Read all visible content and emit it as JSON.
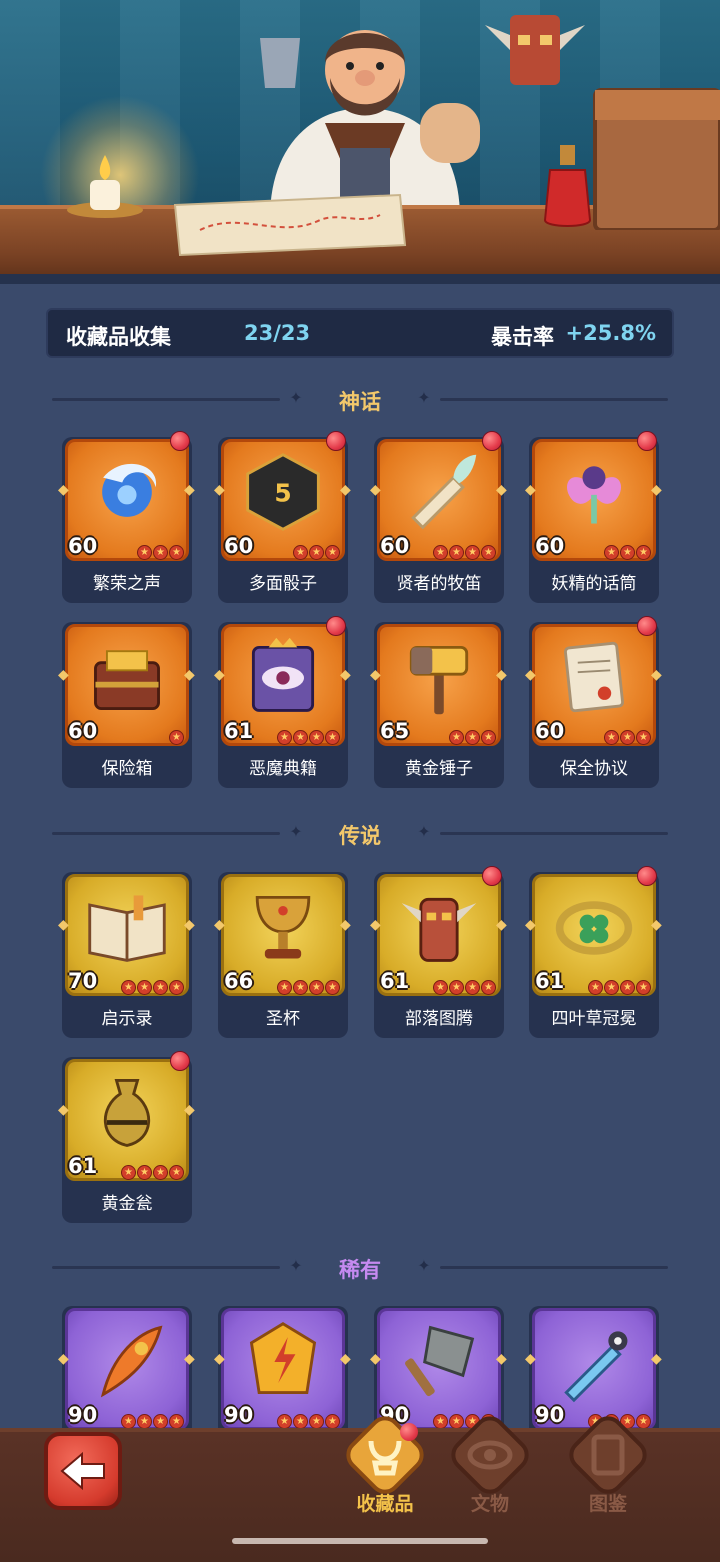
{
  "header": {
    "collection_label": "收藏品收集",
    "collection_count": "23/23",
    "crit_label": "暴击率",
    "crit_value": "+25.8%"
  },
  "sections": [
    {
      "title": "神话",
      "color": "#f3c86b",
      "rarity": "mythic",
      "items": [
        {
          "name": "繁荣之声",
          "level": "60",
          "stars": 3,
          "new": true,
          "icon": "swirl-orb-icon"
        },
        {
          "name": "多面骰子",
          "level": "60",
          "stars": 3,
          "new": true,
          "icon": "d20-dice-icon"
        },
        {
          "name": "贤者的牧笛",
          "level": "60",
          "stars": 4,
          "new": true,
          "icon": "flute-icon"
        },
        {
          "name": "妖精的话筒",
          "level": "60",
          "stars": 3,
          "new": true,
          "icon": "fairy-microphone-icon"
        },
        {
          "name": "保险箱",
          "level": "60",
          "stars": 1,
          "new": false,
          "icon": "treasure-chest-icon"
        },
        {
          "name": "恶魔典籍",
          "level": "61",
          "stars": 4,
          "new": true,
          "icon": "demon-book-icon"
        },
        {
          "name": "黄金锤子",
          "level": "65",
          "stars": 3,
          "new": false,
          "icon": "golden-hammer-icon"
        },
        {
          "name": "保全协议",
          "level": "60",
          "stars": 3,
          "new": true,
          "icon": "scroll-document-icon"
        }
      ]
    },
    {
      "title": "传说",
      "color": "#f3c86b",
      "rarity": "legend",
      "items": [
        {
          "name": "启示录",
          "level": "70",
          "stars": 4,
          "new": false,
          "icon": "open-book-icon"
        },
        {
          "name": "圣杯",
          "level": "66",
          "stars": 4,
          "new": false,
          "icon": "grail-icon"
        },
        {
          "name": "部落图腾",
          "level": "61",
          "stars": 4,
          "new": true,
          "icon": "tribal-totem-icon"
        },
        {
          "name": "四叶草冠冕",
          "level": "61",
          "stars": 4,
          "new": true,
          "icon": "clover-crown-icon"
        },
        {
          "name": "黄金瓮",
          "level": "61",
          "stars": 4,
          "new": true,
          "icon": "golden-urn-icon"
        }
      ]
    },
    {
      "title": "稀有",
      "color": "#c58af0",
      "rarity": "rare",
      "items": [
        {
          "name": "",
          "level": "90",
          "stars": 4,
          "new": false,
          "icon": "phoenix-feather-icon"
        },
        {
          "name": "",
          "level": "90",
          "stars": 4,
          "new": false,
          "icon": "lightning-crystal-icon"
        },
        {
          "name": "",
          "level": "90",
          "stars": 4,
          "new": false,
          "icon": "stone-axe-icon"
        },
        {
          "name": "",
          "level": "90",
          "stars": 4,
          "new": false,
          "icon": "ice-dagger-icon"
        }
      ]
    }
  ],
  "nav": {
    "tabs": [
      {
        "label": "收藏品",
        "color": "#f3c24a",
        "active": true,
        "new": true,
        "icon": "lyre-icon"
      },
      {
        "label": "文物",
        "color": "#8a5a46",
        "active": false,
        "new": false,
        "icon": "eye-icon"
      },
      {
        "label": "图鉴",
        "color": "#8a5a46",
        "active": false,
        "new": false,
        "icon": "book-icon"
      }
    ]
  }
}
